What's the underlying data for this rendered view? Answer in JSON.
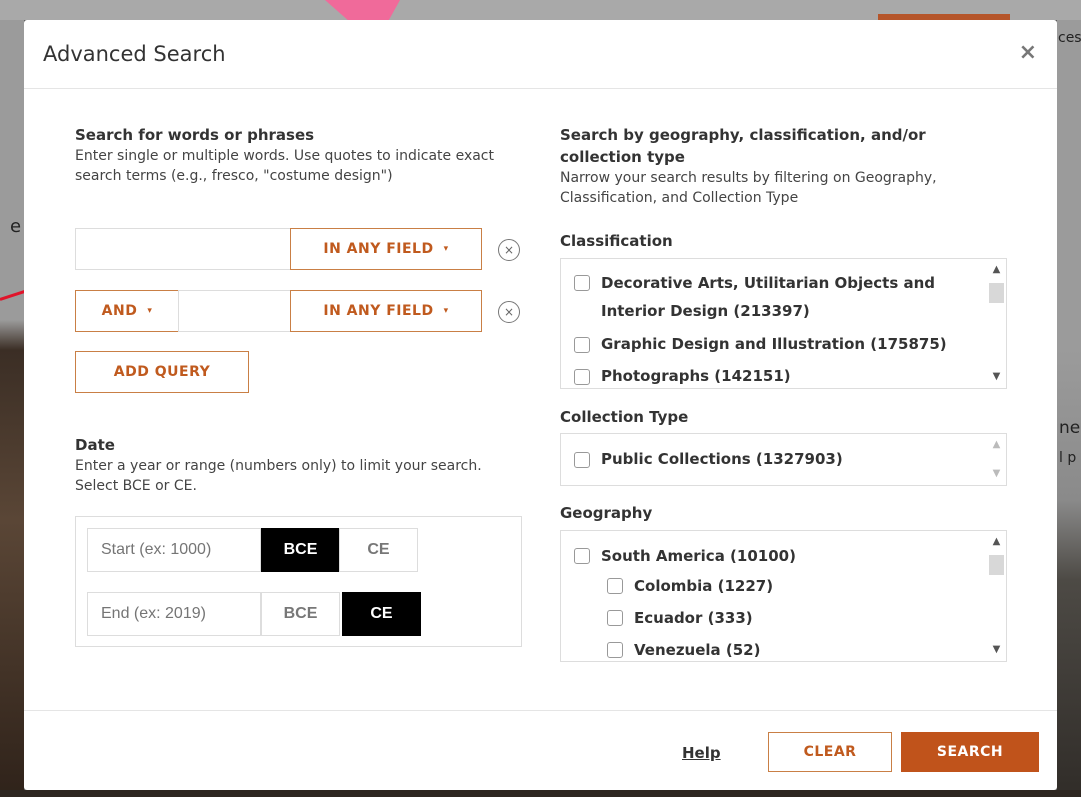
{
  "background": {
    "fragments": [
      "ces",
      "e",
      "ne",
      "l p"
    ]
  },
  "modal": {
    "title": "Advanced Search",
    "close_label": "×"
  },
  "words": {
    "title": "Search for words or phrases",
    "description": "Enter single or multiple words. Use quotes to indicate exact search terms (e.g., fresco, \"costume design\")",
    "rows": [
      {
        "operator": "",
        "value": "",
        "field": "IN ANY FIELD"
      },
      {
        "operator": "AND",
        "value": "",
        "field": "IN ANY FIELD"
      }
    ],
    "caret": "▾",
    "remove_label": "×",
    "add_query_label": "ADD QUERY"
  },
  "date": {
    "title": "Date",
    "description": "Enter a year or range (numbers only) to limit your search. Select BCE or CE.",
    "start": {
      "placeholder": "Start (ex: 1000)",
      "selected_era": "BCE"
    },
    "end": {
      "placeholder": "End (ex: 2019)",
      "selected_era": "CE"
    },
    "era_bce": "BCE",
    "era_ce": "CE"
  },
  "filters": {
    "title": "Search by geography, classification, and/or collection type",
    "description": "Narrow your search results by filtering on Geography, Classification, and Collection Type",
    "classification": {
      "title": "Classification",
      "items": [
        {
          "line1": "Decorative Arts, Utilitarian Objects and",
          "line2": "Interior Design (213397)"
        },
        {
          "line1": "Graphic Design and Illustration (175875)"
        },
        {
          "line1": "Photographs (142151)"
        }
      ]
    },
    "collection_type": {
      "title": "Collection Type",
      "items": [
        {
          "label": "Public Collections (1327903)"
        }
      ]
    },
    "geography": {
      "title": "Geography",
      "items": [
        {
          "label": "South America (10100)",
          "level": 0
        },
        {
          "label": "Colombia (1227)",
          "level": 1
        },
        {
          "label": "Ecuador (333)",
          "level": 1
        },
        {
          "label": "Venezuela (52)",
          "level": 1
        }
      ]
    },
    "scroll_up": "▲",
    "scroll_down": "▼"
  },
  "footer": {
    "help_label": "Help",
    "clear_label": "CLEAR",
    "search_label": "SEARCH"
  },
  "colors": {
    "accent": "#c0531b",
    "accent_border": "#c97f45",
    "active_era": "#000000"
  }
}
